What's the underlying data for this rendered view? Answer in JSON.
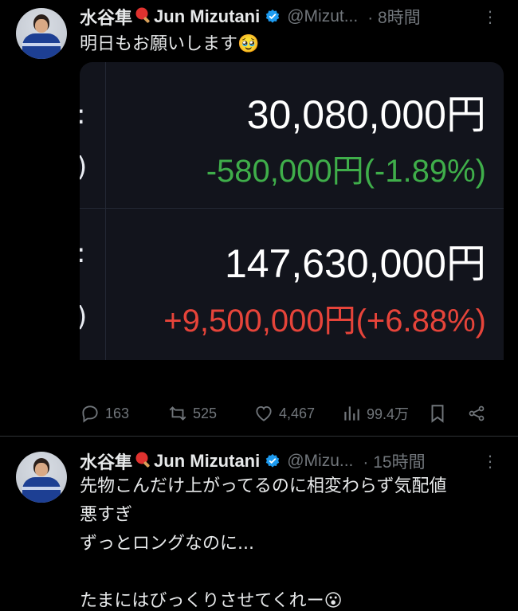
{
  "post1": {
    "name": "水谷隼",
    "name_en": "Jun Mizutani",
    "handle": "@Mizut...",
    "time": "· 8時間",
    "text": "明日もお願いします🥹",
    "card": {
      "top_amount": "30,080,000円",
      "top_change": "-580,000円(-1.89%)",
      "bottom_amount": "147,630,000円",
      "bottom_change": "+9,500,000円(+6.88%)"
    },
    "actions": {
      "replies": "163",
      "reposts": "525",
      "likes": "4,467",
      "views": "99.4万"
    }
  },
  "post2": {
    "name": "水谷隼",
    "name_en": "Jun Mizutani",
    "handle": "@Mizu...",
    "time": "· 15時間",
    "text": "先物こんだけ上がってるのに相変わらず気配値\n悪すぎ\nずっとロングなのに...\n\nたまにはびっくりさせてくれー😮"
  },
  "colors": {
    "background": "#000000",
    "verified": "#1d9bf0",
    "negative": "#3fae4a",
    "positive": "#e6443a",
    "muted": "#71767b"
  },
  "icons": [
    "avatar",
    "ping-pong-paddle-emoji",
    "verified-badge-icon",
    "more-icon",
    "reply-icon",
    "repost-icon",
    "like-icon",
    "views-icon",
    "bookmark-icon",
    "share-icon"
  ]
}
